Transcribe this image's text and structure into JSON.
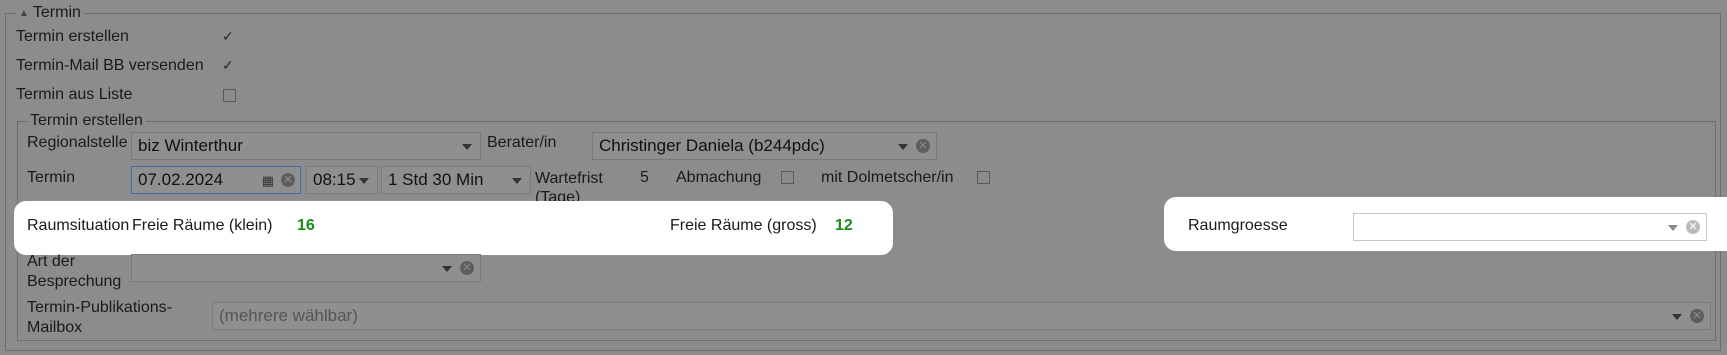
{
  "section": {
    "title": "Termin",
    "rows": [
      {
        "label": "Termin erstellen",
        "checked": true
      },
      {
        "label": "Termin-Mail BB versenden",
        "checked": true
      },
      {
        "label": "Termin aus Liste",
        "checked": false
      }
    ]
  },
  "subsection": {
    "title": "Termin erstellen",
    "regionalstelle_label": "Regionalstelle",
    "regionalstelle_value": "biz Winterthur",
    "berater_label": "Berater/in",
    "berater_value": "Christinger Daniela (b244pdc)",
    "termin_label": "Termin",
    "date_value": "07.02.2024",
    "time_value": "08:15",
    "duration_value": "1 Std 30 Min",
    "wartefrist_label_1": "Wartefrist",
    "wartefrist_label_2": "(Tage)",
    "wartefrist_value": "5",
    "abmachung_label": "Abmachung",
    "abmachung_checked": false,
    "dolmetscher_label": "mit Dolmetscher/in",
    "dolmetscher_checked": false,
    "raumsituation_label": "Raumsituation",
    "freie_klein_label": "Freie Räume (klein)",
    "freie_klein_value": "16",
    "freie_gross_label": "Freie Räume (gross)",
    "freie_gross_value": "12",
    "raumgroesse_label": "Raumgroesse",
    "raumgroesse_value": "",
    "art_label_1": "Art der",
    "art_label_2": "Besprechung",
    "art_value": "",
    "mailbox_label_1": "Termin-Publikations-",
    "mailbox_label_2": "Mailbox",
    "mailbox_placeholder": "(mehrere wählbar)"
  },
  "colors": {
    "accent_green": "#1a8a1a",
    "highlight": "#ffffff"
  }
}
